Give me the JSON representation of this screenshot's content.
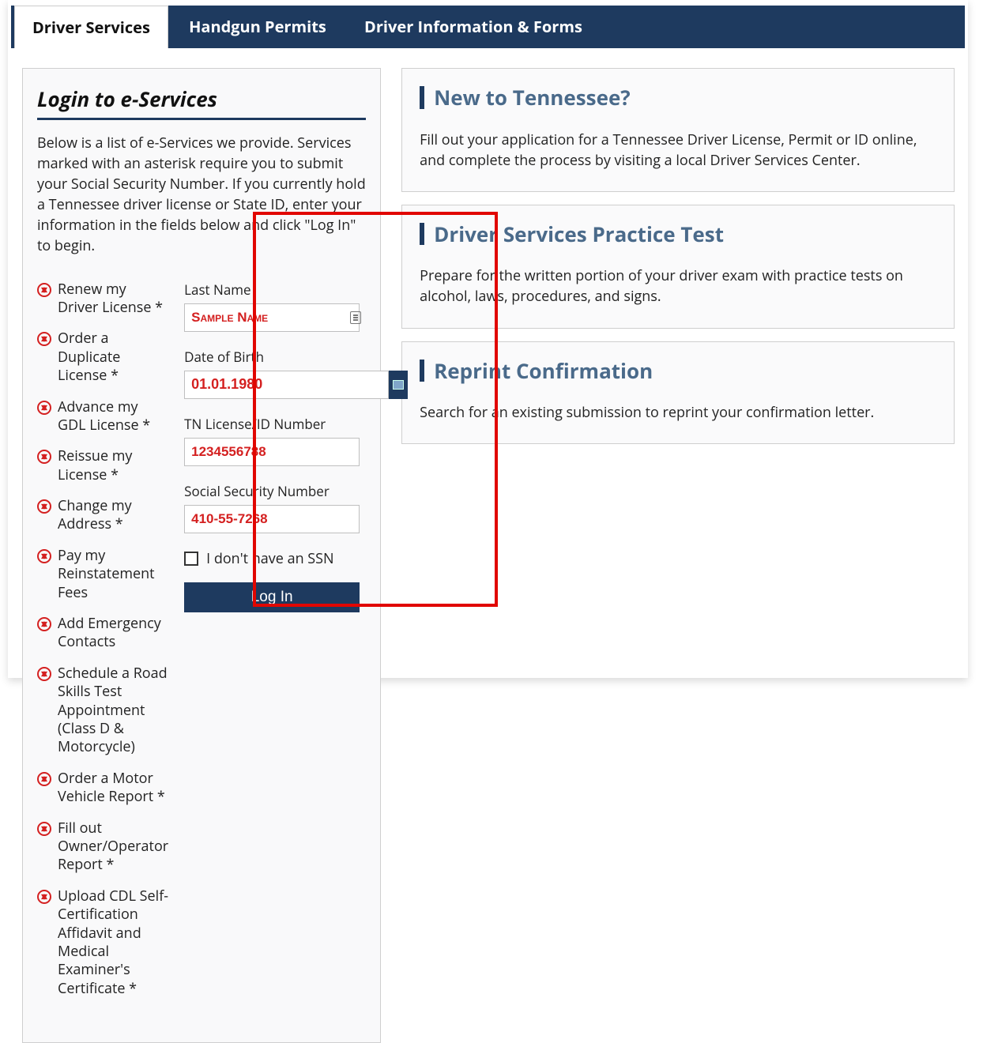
{
  "tabs": {
    "items": [
      {
        "label": "Driver Services",
        "active": true
      },
      {
        "label": "Handgun Permits",
        "active": false
      },
      {
        "label": "Driver Information & Forms",
        "active": false
      }
    ]
  },
  "login_panel": {
    "title": "Login to e-Services",
    "intro": "Below is a list of e-Services we provide. Services marked with an asterisk require you to submit your Social Security Number. If you currently hold a Tennessee driver license or State ID, enter your information in the fields below and click \"Log In\" to begin.",
    "services": [
      "Renew my Driver License *",
      "Order a Duplicate License *",
      "Advance my GDL License *",
      "Reissue my License *",
      "Change my Address *",
      "Pay my Reinstatement Fees",
      "Add Emergency Contacts",
      "Schedule a Road Skills Test Appointment (Class D & Motorcycle)",
      "Order a Motor Vehicle Report *",
      "Fill out Owner/Operator Report *",
      "Upload CDL Self-Certification Affidavit and Medical Examiner's Certificate *"
    ],
    "form": {
      "last_name_label": "Last Name",
      "last_name_value": "Sample Name",
      "dob_label": "Date of Birth",
      "dob_value": "01.01.1980",
      "license_label": "TN License/ID Number",
      "license_value": "1234556788",
      "ssn_label": "Social Security Number",
      "ssn_value": "410-55-7268",
      "no_ssn_label": "I don't have an SSN",
      "submit_label": "Log In"
    }
  },
  "cards": [
    {
      "title": "New to Tennessee?",
      "text": "Fill out your application for a Tennessee Driver License, Permit or ID online, and complete the process by visiting a local Driver Services Center."
    },
    {
      "title": "Driver Services Practice Test",
      "text": "Prepare for the written portion of your driver exam with practice tests on alcohol, laws, procedures, and signs."
    },
    {
      "title": "Reprint Confirmation",
      "text": "Search for an existing submission to reprint your confirmation letter."
    }
  ]
}
